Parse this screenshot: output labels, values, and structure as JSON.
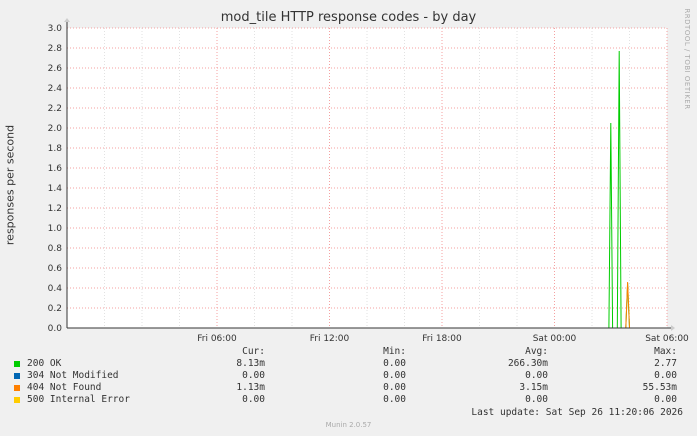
{
  "chart_data": {
    "type": "line",
    "title": "mod_tile HTTP response codes - by day",
    "ylabel": "responses per second",
    "ylim": [
      0,
      3.0
    ],
    "yticks": [
      "0.0",
      "0.2",
      "0.4",
      "0.6",
      "0.8",
      "1.0",
      "1.2",
      "1.4",
      "1.6",
      "1.8",
      "2.0",
      "2.2",
      "2.4",
      "2.6",
      "2.8",
      "3.0"
    ],
    "xticks": [
      "Fri 06:00",
      "Fri 12:00",
      "Fri 18:00",
      "Sat 00:00",
      "Sat 06:00"
    ],
    "xrange_hours": [
      -2,
      30
    ],
    "series": [
      {
        "name": "200 OK",
        "color": "#00cc00",
        "x": [
          26.9,
          27.0,
          27.1,
          27.35,
          27.45,
          27.55,
          27.8,
          27.9,
          28.0
        ],
        "y": [
          0,
          2.05,
          0,
          0,
          2.77,
          0,
          0,
          0.45,
          0
        ]
      },
      {
        "name": "404 Not Found",
        "color": "#ff8000",
        "x": [
          27.8,
          27.9,
          28.0
        ],
        "y": [
          0,
          0.46,
          0
        ]
      }
    ],
    "grid": true
  },
  "legend": {
    "headers": {
      "cur": "Cur:",
      "min": "Min:",
      "avg": "Avg:",
      "max": "Max:"
    },
    "rows": [
      {
        "name": "200 OK",
        "color": "#00cc00",
        "cur": "8.13m",
        "min": "0.00",
        "avg": "266.30m",
        "max": "2.77"
      },
      {
        "name": "304 Not Modified",
        "color": "#0066b3",
        "cur": "0.00",
        "min": "0.00",
        "avg": "0.00",
        "max": "0.00"
      },
      {
        "name": "404 Not Found",
        "color": "#ff8000",
        "cur": "1.13m",
        "min": "0.00",
        "avg": "3.15m",
        "max": "55.53m"
      },
      {
        "name": "500 Internal Error",
        "color": "#ffcc00",
        "cur": "0.00",
        "min": "0.00",
        "avg": "0.00",
        "max": "0.00"
      }
    ]
  },
  "last_update": "Last update: Sat Sep 26 11:20:06 2026",
  "watermark": "RRDTOOL / TOBI OETIKER",
  "footer": "Munin 2.0.57"
}
